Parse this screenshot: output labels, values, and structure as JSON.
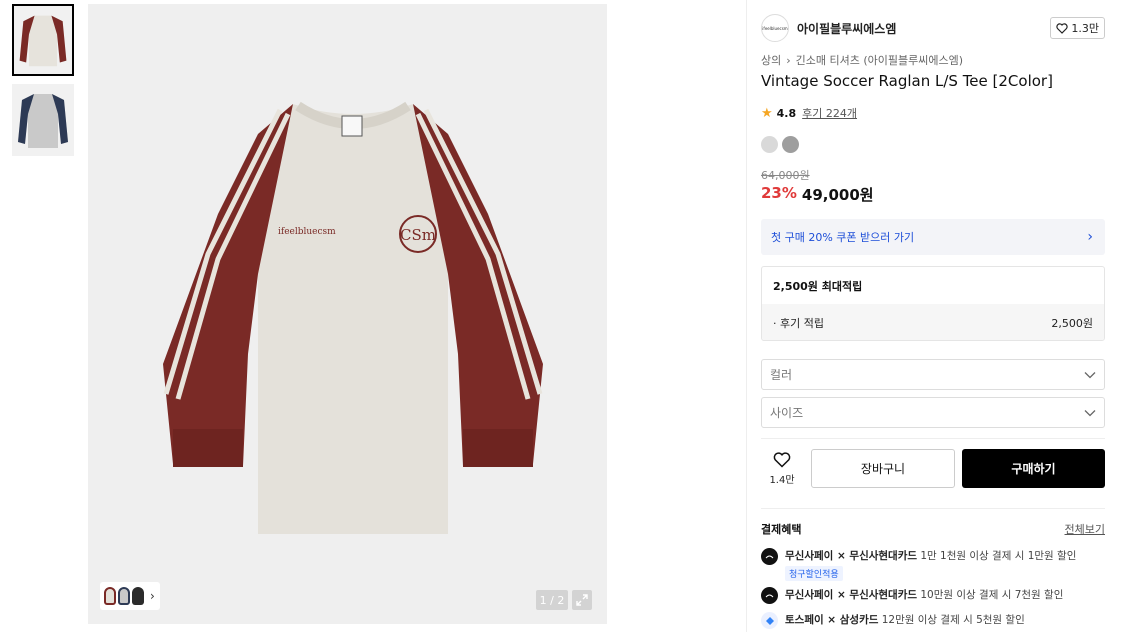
{
  "gallery": {
    "counter": "1 / 2",
    "thumbnail_colors": [
      "#7a2a26",
      "#2d3a55"
    ],
    "shirt_print": "ifeelbluecsm",
    "emblem": "CSm"
  },
  "brand": {
    "logo_text": "ifeelbluecsm",
    "name": "아이필블루씨에스엠",
    "likes": "1.3만"
  },
  "breadcrumb": [
    "상의",
    "긴소매 티셔츠 (아이필블루씨에스엠)"
  ],
  "product": {
    "title": "Vintage Soccer Raglan L/S Tee [2Color]",
    "rating": "4.8",
    "reviews": "후기 224개",
    "swatch_colors": [
      "#d9d9d9",
      "#9e9e9e"
    ],
    "original_price": "64,000원",
    "discount": "23%",
    "price": "49,000원"
  },
  "coupon": {
    "label": "첫 구매 20% 쿠폰 받으러 가기"
  },
  "points": {
    "title": "2,500원 최대적립",
    "row_label": "· 후기 적립",
    "row_value": "2,500원"
  },
  "options": {
    "color_placeholder": "컬러",
    "size_placeholder": "사이즈"
  },
  "actions": {
    "wish_count": "1.4만",
    "cart_label": "장바구니",
    "buy_label": "구매하기"
  },
  "benefits": {
    "title": "결제혜택",
    "more": "전체보기",
    "items": [
      {
        "partner": "무신사페이 × 무신사현대카드",
        "detail": "1만 1천원 이상 결제 시 1만원 할인",
        "tag": "청구할인적용"
      },
      {
        "partner": "무신사페이 × 무신사현대카드",
        "detail": "10만원 이상 결제 시 7천원 할인"
      },
      {
        "partner": "토스페이 × 삼성카드",
        "detail": "12만원 이상 결제 시 5천원 할인"
      }
    ]
  }
}
